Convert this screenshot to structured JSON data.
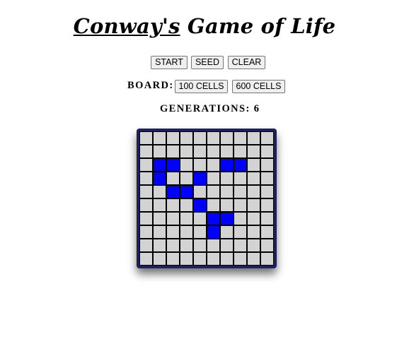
{
  "title": {
    "part1": "Conway's",
    "part2": " Game of Life"
  },
  "controls": {
    "start_label": "START",
    "seed_label": "SEED",
    "clear_label": "CLEAR"
  },
  "board": {
    "label": "BOARD:",
    "size_100_label": "100 CELLS",
    "size_600_label": "600 CELLS"
  },
  "generations": {
    "label": "GENERATIONS:",
    "value": "6"
  },
  "colors": {
    "alive": "#0000ff",
    "dead": "#d3d3d3",
    "frame": "#1f1f5e"
  },
  "grid": {
    "rows": 10,
    "cols": 10,
    "cells": [
      [
        0,
        0,
        0,
        0,
        0,
        0,
        0,
        0,
        0,
        0
      ],
      [
        0,
        0,
        0,
        0,
        0,
        0,
        0,
        0,
        0,
        0
      ],
      [
        0,
        1,
        1,
        0,
        0,
        0,
        1,
        1,
        0,
        0
      ],
      [
        0,
        1,
        0,
        0,
        1,
        0,
        0,
        0,
        0,
        0
      ],
      [
        0,
        0,
        1,
        1,
        0,
        0,
        0,
        0,
        0,
        0
      ],
      [
        0,
        0,
        0,
        0,
        1,
        0,
        0,
        0,
        0,
        0
      ],
      [
        0,
        0,
        0,
        0,
        0,
        1,
        1,
        0,
        0,
        0
      ],
      [
        0,
        0,
        0,
        0,
        0,
        1,
        0,
        0,
        0,
        0
      ],
      [
        0,
        0,
        0,
        0,
        0,
        0,
        0,
        0,
        0,
        0
      ],
      [
        0,
        0,
        0,
        0,
        0,
        0,
        0,
        0,
        0,
        0
      ]
    ]
  }
}
